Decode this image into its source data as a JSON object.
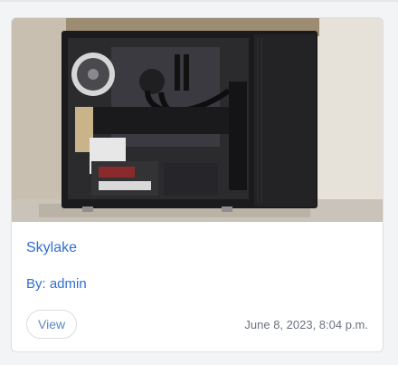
{
  "post": {
    "title": "Skylake",
    "author": "By: admin",
    "view_label": "View",
    "date": "June 8, 2023, 8:04 p.m.",
    "image_icon": "pc-case-photo"
  },
  "colors": {
    "link": "#2f6fd1",
    "muted": "#6b7280",
    "border": "#dcdfe3"
  }
}
